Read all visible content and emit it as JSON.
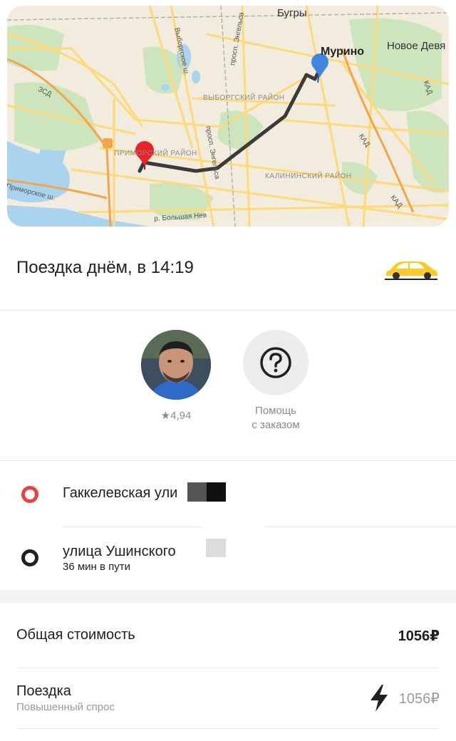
{
  "map": {
    "labels": {
      "bugry": "Бугры",
      "murino": "Мурино",
      "novoe_devyatkino": "Новое Девя",
      "vyborgsky": "ВЫБОРГСКИЙ РАЙОН",
      "kalininsky": "КАЛИНИНСКИЙ РАЙОН",
      "primorsky": "ПРИМОРСКИЙ РАЙОН",
      "zsd": "ЗСД",
      "kad1": "КАД",
      "kad2": "КАД",
      "vyborgskoe_sh": "Выборгское ш.",
      "engelsa1": "просп. Энгельса",
      "engelsa2": "просп. Энгельса",
      "primorskoe_sh": "Приморское ш.",
      "bolshaya_nevka": "р. Большая Нев",
      "kad3": "КАД"
    },
    "colors": {
      "route": "#3a3a3a",
      "start_pin": "#e8232a",
      "end_pin": "#3f86e0"
    }
  },
  "ride": {
    "title": "Поездка днём, в 14:19",
    "tariff_icon": "taxi-car-icon"
  },
  "driver": {
    "rating": "★4,94",
    "help_label_line1": "Помощь",
    "help_label_line2": "с заказом",
    "help_icon": "question-circle-icon"
  },
  "route": {
    "from": "Гаккелевская ули",
    "to": "улица Ушинского",
    "duration": "36 мин в пути"
  },
  "cost": {
    "total_label": "Общая стоимость",
    "total_value": "1056₽",
    "ride_label": "Поездка",
    "ride_sublabel": "Повышенный спрос",
    "ride_value": "1056₽",
    "surge_icon": "lightning-icon"
  }
}
